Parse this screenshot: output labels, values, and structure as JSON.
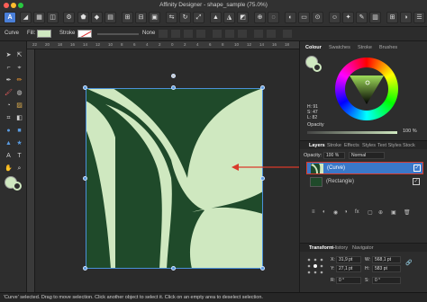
{
  "window": {
    "title": "Affinity Designer - shape_sample (75.0%)"
  },
  "context_bar": {
    "tool_name": "Curve",
    "fill_label": "Fill:",
    "stroke_label": "Stroke",
    "stroke_value": "None"
  },
  "ruler": {
    "ticks": [
      "22",
      "20",
      "18",
      "16",
      "14",
      "12",
      "10",
      "8",
      "6",
      "4",
      "2",
      "0",
      "2",
      "4",
      "6",
      "8",
      "10",
      "12",
      "14",
      "16",
      "18"
    ]
  },
  "color_panel": {
    "tabs": [
      "Colour",
      "Swatches",
      "Stroke",
      "Brushes"
    ],
    "h": "H: 91",
    "s": "S: 47",
    "l": "L: 82",
    "opacity_label": "Opacity",
    "opacity_value": "100 %"
  },
  "layers_panel": {
    "tabs": [
      "Layers",
      "Stroke",
      "Effects",
      "Styles",
      "Text Styles",
      "Stock"
    ],
    "opacity_label": "Opacity:",
    "opacity_value": "100 %",
    "blend_mode": "Normal",
    "items": [
      {
        "name": "(Curve)",
        "selected": true
      },
      {
        "name": "(Rectangle)",
        "selected": false
      }
    ]
  },
  "transform_panel": {
    "tabs": [
      "Transform",
      "History",
      "Navigator"
    ],
    "x_label": "X:",
    "x_value": "31,9 pt",
    "y_label": "Y:",
    "y_value": "27,1 pt",
    "w_label": "W:",
    "w_value": "568,1 pt",
    "h_label": "H:",
    "h_value": "583 pt",
    "r_label": "R:",
    "r_value": "0 °",
    "s_label": "S:",
    "s_value": "0 °"
  },
  "status": {
    "text": "'Curve' selected. Drag to move selection. Click another object to select it. Click on an empty area to deselect selection."
  },
  "colors": {
    "artboard_dark": "#1f4a2a",
    "shape_light": "#cfe8c0",
    "selection_blue": "#4a90d9",
    "highlight_red": "#d93a2b"
  }
}
